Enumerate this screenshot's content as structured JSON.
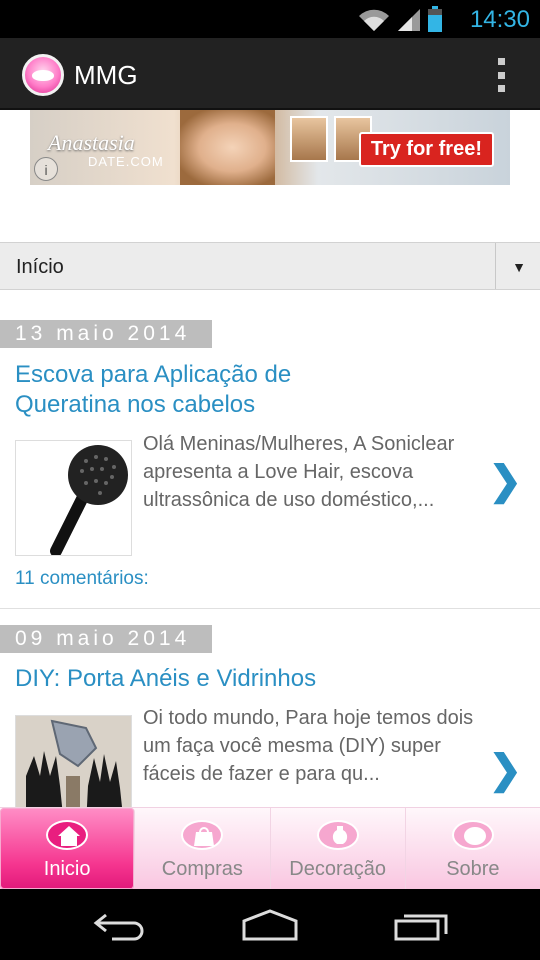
{
  "status_bar": {
    "time": "14:30"
  },
  "action_bar": {
    "title": "MMG"
  },
  "ad": {
    "brand": "Anastasia",
    "brand_sub": "DATE.COM",
    "cta": "Try for free!",
    "info": "i"
  },
  "spinner": {
    "selected": "Início"
  },
  "posts": [
    {
      "date": "13 maio 2014",
      "title": "Escova para Aplicação de Queratina nos cabelos",
      "excerpt": "Olá Meninas/Mulheres, A Soniclear apresenta a Love Hair, escova ultrassônica de uso doméstico,...",
      "comments": "11 comentários:"
    },
    {
      "date": "09 maio 2014",
      "title": "DIY: Porta Anéis e Vidrinhos",
      "excerpt": "Oi todo mundo, Para hoje temos dois um faça você mesma (DIY) super  fáceis de fazer   e para qu..."
    }
  ],
  "tabs": [
    {
      "label": "Inicio",
      "active": true,
      "icon": "home-icon"
    },
    {
      "label": "Compras",
      "active": false,
      "icon": "shopping-bag-icon"
    },
    {
      "label": "Decoração",
      "active": false,
      "icon": "vase-icon"
    },
    {
      "label": "Sobre",
      "active": false,
      "icon": "lips-icon"
    }
  ],
  "colors": {
    "accent": "#2a8fc3",
    "tab_active": "#f5358f",
    "date_tag": "#bdbdbd"
  }
}
